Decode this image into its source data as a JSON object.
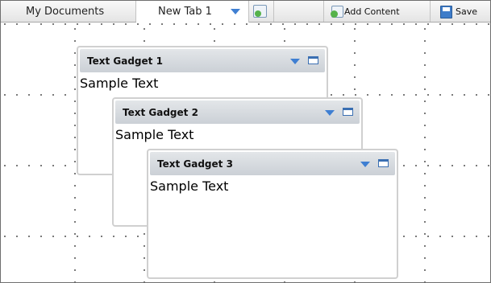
{
  "toolbar": {
    "tabs": [
      {
        "label": "My Documents"
      },
      {
        "label": "New Tab 1"
      }
    ],
    "add_content_label": "Add Content",
    "save_label": "Save"
  },
  "gadgets": [
    {
      "title": "Text Gadget 1",
      "body": "Sample Text"
    },
    {
      "title": "Text Gadget 2",
      "body": "Sample Text"
    },
    {
      "title": "Text Gadget 3",
      "body": "Sample Text"
    }
  ],
  "icons": {
    "tab_menu": "chevron-down-icon",
    "new_tab": "add-tab-icon",
    "add_content": "add-content-icon",
    "save": "save-icon",
    "gadget_menu": "chevron-down-icon",
    "gadget_maximize": "maximize-icon"
  },
  "colors": {
    "accent": "#3f7fd2",
    "gadget_header": "#cbd0d6",
    "toolbar_bg": "#e4e4e4"
  }
}
